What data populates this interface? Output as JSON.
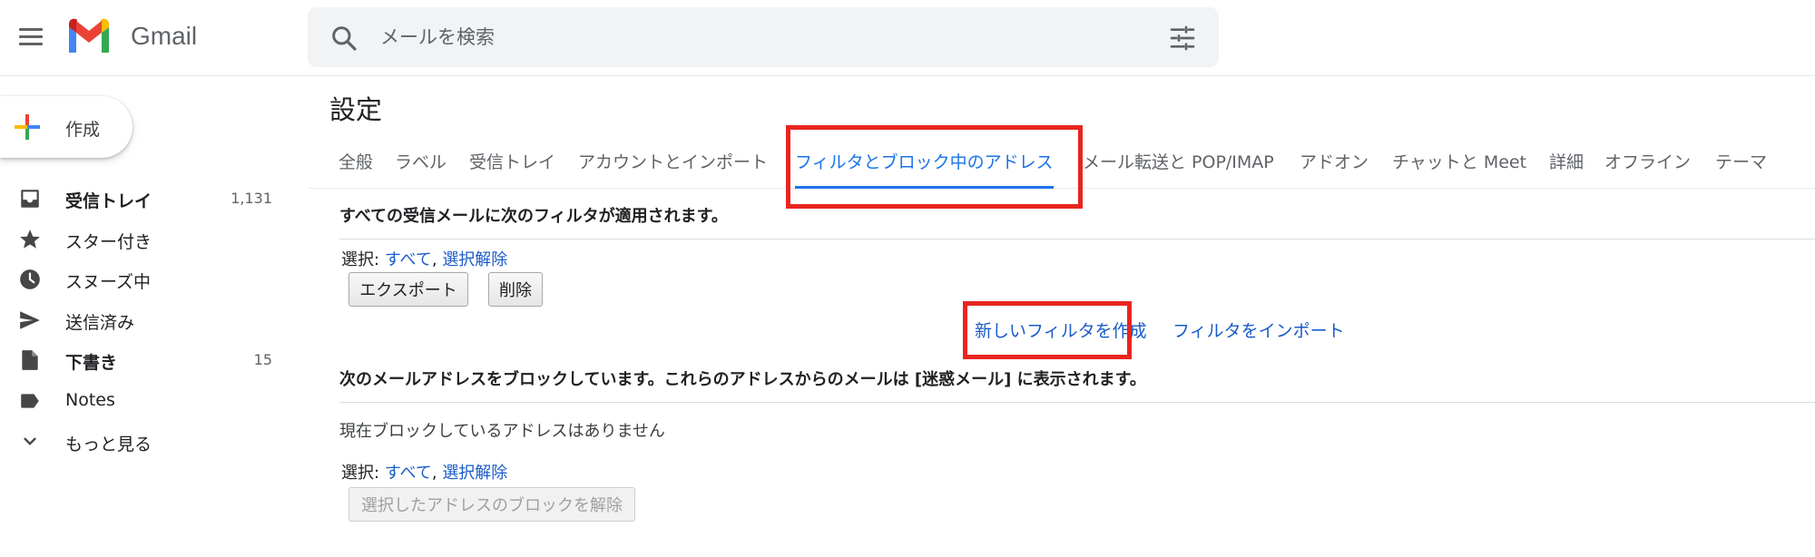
{
  "app": {
    "logo_text": "Gmail"
  },
  "search": {
    "placeholder": "メールを検索"
  },
  "compose": {
    "label": "作成"
  },
  "sidebar": {
    "items": [
      {
        "label": "受信トレイ",
        "count": "1,131",
        "icon": "inbox-icon",
        "bold": true
      },
      {
        "label": "スター付き",
        "count": "",
        "icon": "star-icon",
        "bold": false
      },
      {
        "label": "スヌーズ中",
        "count": "",
        "icon": "clock-icon",
        "bold": false
      },
      {
        "label": "送信済み",
        "count": "",
        "icon": "send-icon",
        "bold": false
      },
      {
        "label": "下書き",
        "count": "15",
        "icon": "draft-icon",
        "bold": true
      },
      {
        "label": "Notes",
        "count": "",
        "icon": "label-icon",
        "bold": false
      },
      {
        "label": "もっと見る",
        "count": "",
        "icon": "chevron-down-icon",
        "bold": false
      }
    ]
  },
  "settings": {
    "title": "設定",
    "tabs": [
      {
        "label": "全般"
      },
      {
        "label": "ラベル"
      },
      {
        "label": "受信トレイ"
      },
      {
        "label": "アカウントとインポート"
      },
      {
        "label": "フィルタとブロック中のアドレス",
        "active": true
      },
      {
        "label": "メール転送と POP/IMAP"
      },
      {
        "label": "アドオン"
      },
      {
        "label": "チャットと Meet"
      },
      {
        "label": "詳細"
      },
      {
        "label": "オフライン"
      },
      {
        "label": "テーマ"
      }
    ],
    "filters": {
      "heading": "すべての受信メールに次のフィルタが適用されます。",
      "select_prefix": "選択:",
      "select_all": "すべて",
      "select_separator": ",",
      "select_none": "選択解除",
      "export_button": "エクスポート",
      "delete_button": "削除",
      "create_filter_link": "新しいフィルタを作成",
      "import_filter_link": "フィルタをインポート"
    },
    "blocked": {
      "heading": "次のメールアドレスをブロックしています。これらのアドレスからのメールは [迷惑メール] に表示されます。",
      "empty_text": "現在ブロックしているアドレスはありません",
      "select_prefix": "選択:",
      "select_all": "すべて",
      "select_separator": ",",
      "select_none": "選択解除",
      "unblock_button": "選択したアドレスのブロックを解除"
    }
  },
  "colors": {
    "accent": "#1a73e8",
    "link": "#1a5cc8",
    "highlight": "#e8251f"
  }
}
